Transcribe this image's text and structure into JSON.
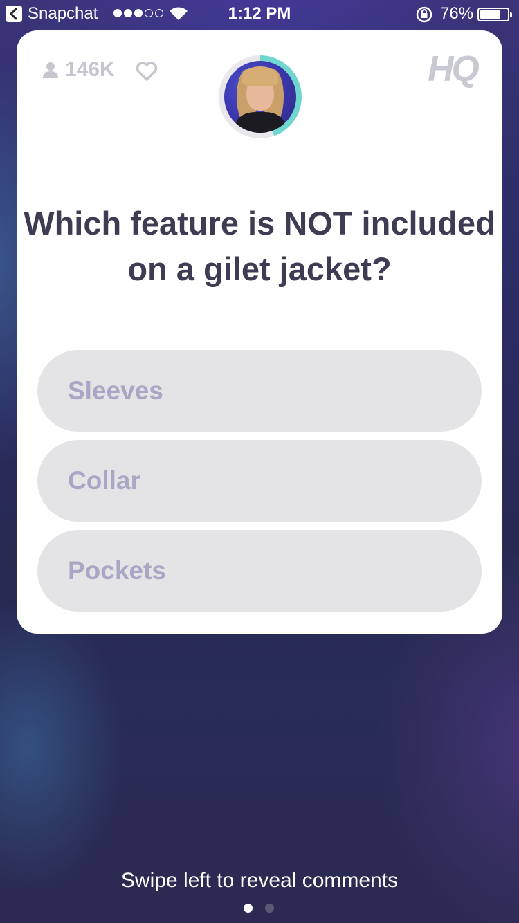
{
  "status_bar": {
    "back_app": "Snapchat",
    "time": "1:12 PM",
    "battery": "76%",
    "battery_level": 0.76,
    "signal_bars_filled": 3,
    "signal_bars_total": 5
  },
  "card": {
    "viewers": "146K",
    "logo": "HQ",
    "question": "Which feature is NOT included on a gilet jacket?",
    "answers": [
      {
        "label": "Sleeves"
      },
      {
        "label": "Collar"
      },
      {
        "label": "Pockets"
      }
    ]
  },
  "footer": {
    "hint": "Swipe left to reveal comments",
    "page_count": 2,
    "active_page": 1
  },
  "colors": {
    "question": "#3e3c53",
    "answer_bg": "#e4e4e6",
    "answer_text": "#a9a7c4",
    "timer_ring": "#6fd6d0"
  }
}
